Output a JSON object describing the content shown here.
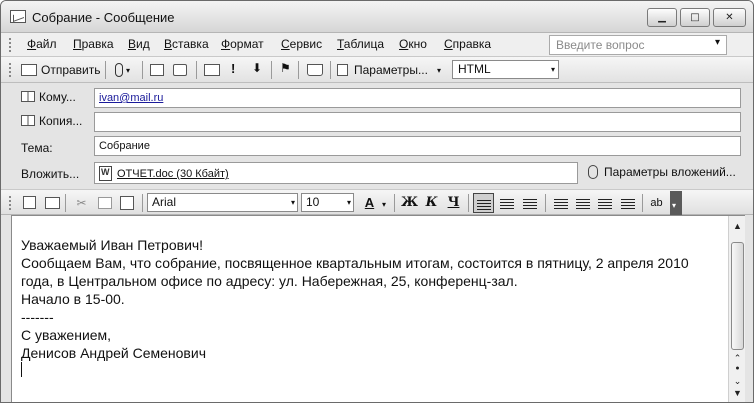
{
  "window": {
    "title": "Собрание - Сообщение",
    "controls": {
      "minimize": "▁",
      "maximize": "□",
      "close": "✕"
    }
  },
  "menu": {
    "items": [
      "Файл",
      "Правка",
      "Вид",
      "Вставка",
      "Формат",
      "Сервис",
      "Таблица",
      "Окно",
      "Справка"
    ],
    "help_placeholder": "Введите вопрос",
    "help_arrow": "▾"
  },
  "toolbar": {
    "send_label": "Отправить",
    "options_label": "Параметры...",
    "format_value": "HTML",
    "icons": [
      "send-icon",
      "attach-icon",
      "address-book-icon",
      "check-names-icon",
      "envelope-icon",
      "high-importance-icon",
      "low-importance-icon",
      "flag-icon",
      "options-icon"
    ]
  },
  "header": {
    "to_label": "Кому...",
    "to_value": "ivan@mail.ru",
    "cc_label": "Копия...",
    "cc_value": "",
    "subject_label": "Тема:",
    "subject_value": "Собрание",
    "attach_label": "Вложить...",
    "attach_file": "ОТЧЕТ.doc (30 Кбайт)",
    "attach_params_label": "Параметры вложений..."
  },
  "format_toolbar": {
    "font_name": "Arial",
    "font_size": "10",
    "font_color_label": "А",
    "bold_label": "Ж",
    "italic_label": "К",
    "underline_label": "Ч",
    "spell_label": "ab",
    "icons": [
      "save-icon",
      "print-icon",
      "cut-icon",
      "copy-icon",
      "paste-icon",
      "align-left-icon",
      "align-center-icon",
      "align-right-icon",
      "numbered-list-icon",
      "bulleted-list-icon",
      "decrease-indent-icon",
      "increase-indent-icon",
      "spelling-icon"
    ]
  },
  "body": {
    "lines": [
      "Уважаемый Иван Петрович!",
      "Сообщаем Вам, что собрание, посвященное квартальным итогам, состоится в пятницу, 2 апреля 2010 года, в Центральном офисе по адресу: ул. Набережная, 25, конференц-зал.",
      "Начало в 15-00.",
      "-------",
      "С уважением,",
      "Денисов Андрей Семенович"
    ]
  },
  "scrollbar": {
    "up": "▲",
    "down": "▼",
    "prev": "⌃",
    "next": "⌄",
    "select": "●"
  }
}
